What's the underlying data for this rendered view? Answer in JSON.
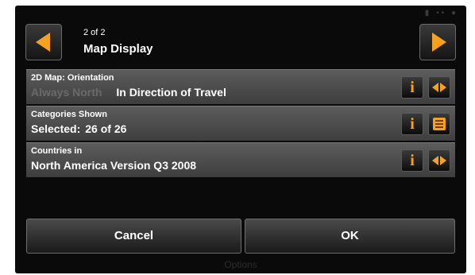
{
  "header": {
    "page_count": "2 of 2",
    "title": "Map Display",
    "prev_icon": "arrow-left-icon",
    "next_icon": "arrow-right-icon"
  },
  "rows": [
    {
      "label": "2D Map: Orientation",
      "option_inactive": "Always North",
      "option_active": "In Direction of Travel",
      "info_icon": "info-icon",
      "action_icon": "left-right-arrows-icon"
    },
    {
      "label": "Categories Shown",
      "value_label": "Selected:",
      "value": "26 of 26",
      "info_icon": "info-icon",
      "action_icon": "list-icon"
    },
    {
      "label": "Countries in",
      "value": "North America Version Q3 2008",
      "info_icon": "info-icon",
      "action_icon": "left-right-arrows-icon"
    }
  ],
  "footer": {
    "cancel_label": "Cancel",
    "ok_label": "OK"
  },
  "background": {
    "bottom_text": "Options"
  },
  "colors": {
    "accent": "#f7a21a",
    "row_bg": "#4e4e4e",
    "screen_bg": "#0a0a0a",
    "inactive_text": "#6a6a6a"
  }
}
